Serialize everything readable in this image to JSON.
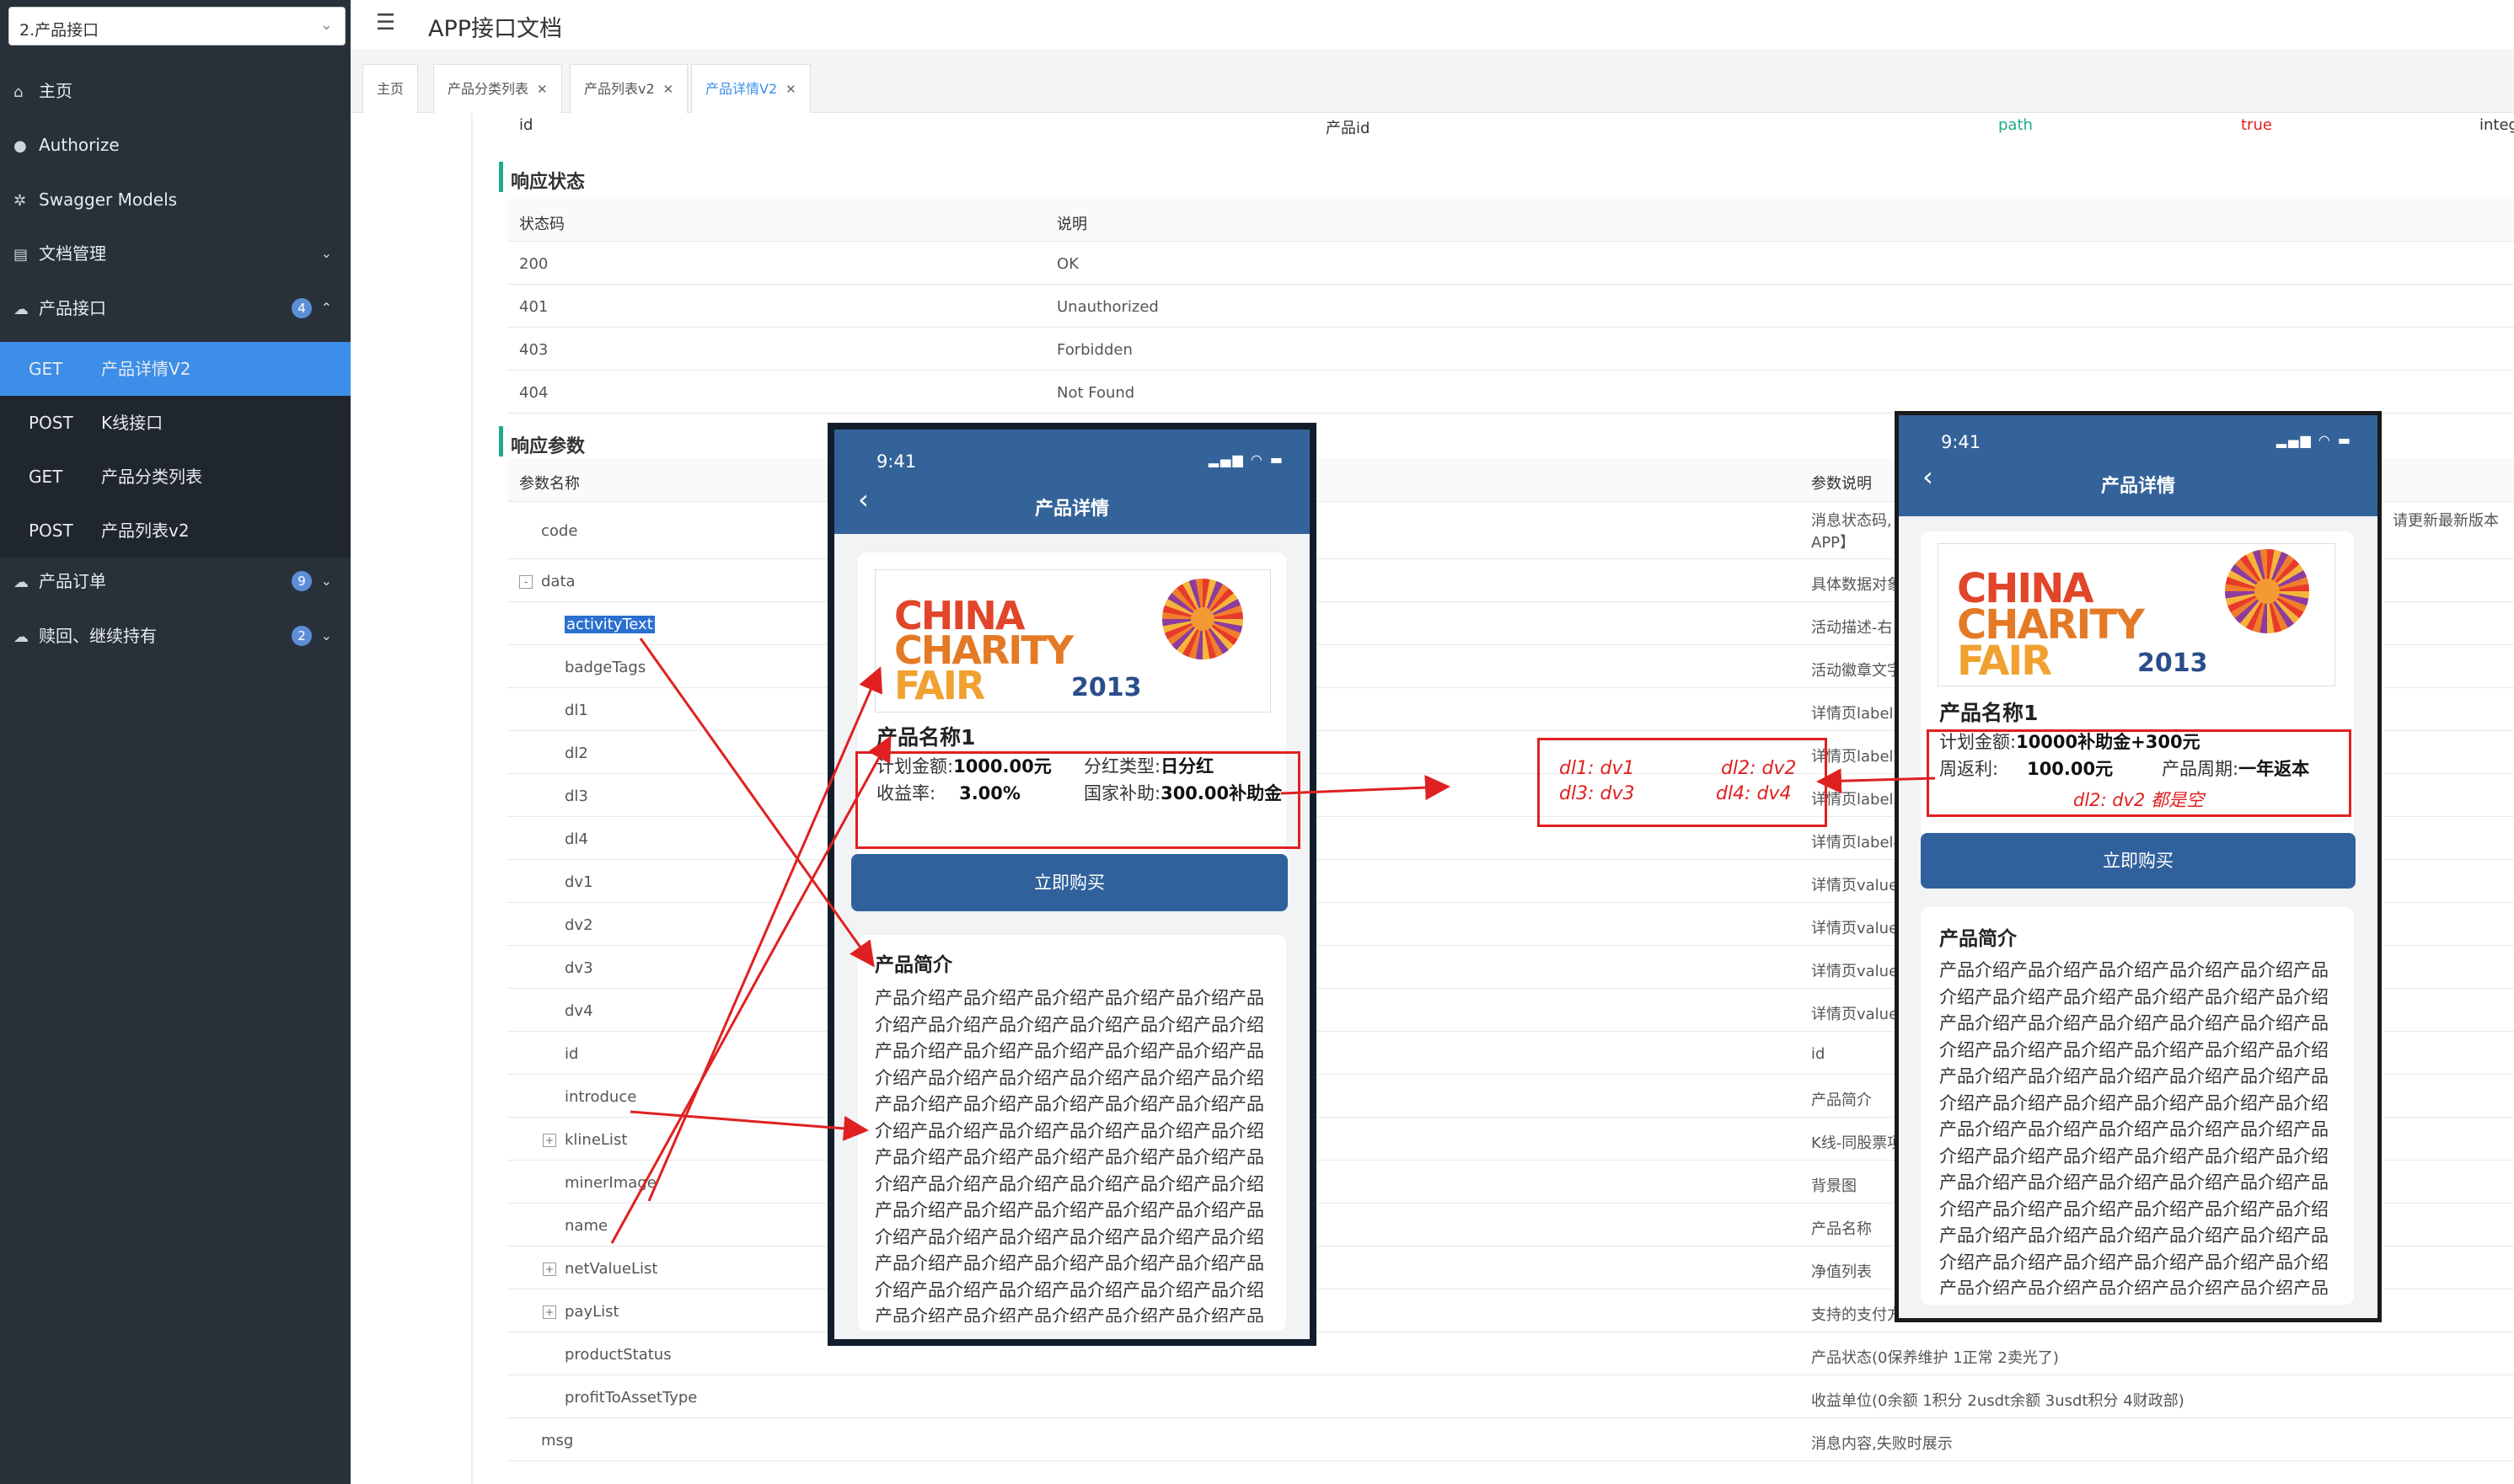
{
  "sidebar": {
    "api_group": "2.产品接口",
    "items": [
      {
        "label": "主页",
        "icon": "home-icon"
      },
      {
        "label": "Authorize",
        "icon": "lock-icon"
      },
      {
        "label": "Swagger Models",
        "icon": "gear-icon"
      },
      {
        "label": "文档管理",
        "icon": "doc-icon"
      },
      {
        "label": "产品接口",
        "icon": "cloud-icon",
        "badge": "4"
      },
      {
        "label": "产品订单",
        "icon": "cloud-icon",
        "badge": "9"
      },
      {
        "label": "赎回、继续持有",
        "icon": "cloud-icon",
        "badge": "2"
      }
    ],
    "sub_items": [
      {
        "method": "GET",
        "label": "产品详情V2"
      },
      {
        "method": "POST",
        "label": "K线接口"
      },
      {
        "method": "GET",
        "label": "产品分类列表"
      },
      {
        "method": "POST",
        "label": "产品列表v2"
      }
    ]
  },
  "header": {
    "title": "APP接口文档"
  },
  "tabs": [
    {
      "label": "主页"
    },
    {
      "label": "产品分类列表"
    },
    {
      "label": "产品列表v2"
    },
    {
      "label": "产品详情V2"
    }
  ],
  "top_param_row": {
    "name": "id",
    "desc": "产品id",
    "in": "path",
    "required": "true",
    "type": "integ"
  },
  "response_status": {
    "title": "响应状态",
    "headers": [
      "状态码",
      "说明"
    ],
    "rows": [
      {
        "code": "200",
        "desc": "OK"
      },
      {
        "code": "401",
        "desc": "Unauthorized"
      },
      {
        "code": "403",
        "desc": "Forbidden"
      },
      {
        "code": "404",
        "desc": "Not Found"
      }
    ]
  },
  "response_params": {
    "title": "响应参数",
    "headers": [
      "参数名称",
      "参数说明"
    ],
    "rows": [
      {
        "name": "code",
        "desc": "消息状态码,【成功:200】, 【失败:500】, 【401, 未登录",
        "desc2": "APP】",
        "desc_right": "请更新最新版本"
      },
      {
        "name": "data",
        "desc": "具体数据对象",
        "expander": "-"
      },
      {
        "name": "activityText",
        "desc": "活动描述-右",
        "highlight": true
      },
      {
        "name": "badgeTags",
        "desc": "活动徽章文字-左"
      },
      {
        "name": "dl1",
        "desc": "详情页label1"
      },
      {
        "name": "dl2",
        "desc": "详情页label2"
      },
      {
        "name": "dl3",
        "desc": "详情页label3"
      },
      {
        "name": "dl4",
        "desc": "详情页label4"
      },
      {
        "name": "dv1",
        "desc": "详情页value1"
      },
      {
        "name": "dv2",
        "desc": "详情页value2"
      },
      {
        "name": "dv3",
        "desc": "详情页value3"
      },
      {
        "name": "dv4",
        "desc": "详情页value4"
      },
      {
        "name": "id",
        "desc": "id"
      },
      {
        "name": "introduce",
        "desc": "产品简介"
      },
      {
        "name": "klineList",
        "desc": "K线-同股票项目,为空则不展示",
        "expander": "+"
      },
      {
        "name": "minerImage",
        "desc": "背景图"
      },
      {
        "name": "name",
        "desc": "产品名称"
      },
      {
        "name": "netValueList",
        "desc": "净值列表",
        "expander": "+"
      },
      {
        "name": "payList",
        "desc": "支持的支付方式列表",
        "expander": "+"
      },
      {
        "name": "productStatus",
        "desc": "产品状态(0保养维护 1正常 2卖光了)"
      },
      {
        "name": "profitToAssetType",
        "desc": "收益单位(0余额 1积分 2usdt余额 3usdt积分 4财政部)"
      },
      {
        "name": "msg",
        "desc": "消息内容,失败时展示"
      }
    ]
  },
  "phone1": {
    "time": "9:41",
    "title": "产品详情",
    "logo": {
      "line1": "CHINA",
      "line2": "CHARITY",
      "line3": "FAIR",
      "year": "2013"
    },
    "name": "产品名称1",
    "info": [
      {
        "label": "计划金额:",
        "value": "1000.00元"
      },
      {
        "label": "分红类型:",
        "value": "日分红"
      },
      {
        "label": "收益率:",
        "value": "3.00%"
      },
      {
        "label": "国家补助:",
        "value": "300.00补助金"
      }
    ],
    "buy": "立即购买",
    "intro_title": "产品简介",
    "intro_text": "产品介绍产品介绍产品介绍产品介绍产品介绍产品介绍产品介绍产品介绍产品介绍产品介绍产品介绍产品介绍产品介绍产品介绍产品介绍产品介绍产品介绍产品介绍产品介绍产品介绍产品介绍产品介绍产品介绍产品介绍产品介绍产品介绍产品介绍产品介绍产品介绍产品介绍产品介绍产品介绍产品介绍产品介绍产品介绍产品介绍产品介绍产品介绍产品介绍产品介绍产品介绍产品介绍产品介绍产品介绍产品介绍产品介绍产品介绍产品介绍产品介绍产品介绍产品介绍产品介绍产品介绍产品介绍产品介绍产品介绍产品介绍产品介绍产品介绍产品介绍产品介绍产品介绍产品介绍产品介绍产品介绍产品介绍产品介绍产品介绍产品介绍产品介绍产品介绍产品介绍产品介绍产品介绍产品介绍产品介绍产品介绍产品介绍产品介绍产品介绍产品介绍产品介绍产品介绍产品介绍产品介绍产品介绍产品介绍产品介绍产品介绍产品介绍产品介"
  },
  "phone2": {
    "time": "9:41",
    "title": "产品详情",
    "logo": {
      "line1": "CHINA",
      "line2": "CHARITY",
      "line3": "FAIR",
      "year": "2013"
    },
    "name": "产品名称1",
    "info": [
      {
        "label": "计划金额:",
        "value": "10000补助金+300元"
      },
      {
        "label": "周返利:",
        "value": "100.00元"
      },
      {
        "label": "产品周期:",
        "value": "一年返本"
      }
    ],
    "buy": "立即购买",
    "intro_title": "产品简介",
    "intro_text": "产品介绍产品介绍产品介绍产品介绍产品介绍产品介绍产品介绍产品介绍产品介绍产品介绍产品介绍产品介绍产品介绍产品介绍产品介绍产品介绍产品介绍产品介绍产品介绍产品介绍产品介绍产品介绍产品介绍产品介绍产品介绍产品介绍产品介绍产品介绍产品介绍产品介绍产品介绍产品介绍产品介绍产品介绍产品介绍产品介绍产品介绍产品介绍产品介绍产品介绍产品介绍产品介绍产品介绍产品介绍产品介绍产品介绍产品介绍产品介绍产品介绍产品介绍产品介绍产品介绍产品介绍产品介绍产品介绍产品介绍产品介绍产品介绍产品介绍产品介绍产品介绍产品介绍产品介绍产品介绍产品介绍产品介绍产品介绍产品介绍产品介绍产品介绍产品介绍产品介绍产品介绍产品介绍产品介绍产品介绍产品介绍产品介绍产品介绍产品介绍产品介绍产品介绍产品介绍产品介"
  },
  "annotations": {
    "mapping_a": "dl1: dv1",
    "mapping_b": "dl2: dv2",
    "mapping_c": "dl3: dv3",
    "mapping_d": "dl4: dv4",
    "note": "dl2: dv2 都是空"
  },
  "colors": {
    "sidebar_bg": "#28313a",
    "active": "#3c8ee8",
    "accent_green": "#1fab89",
    "phone_header": "#34639a",
    "annotation_red": "#e02020"
  }
}
